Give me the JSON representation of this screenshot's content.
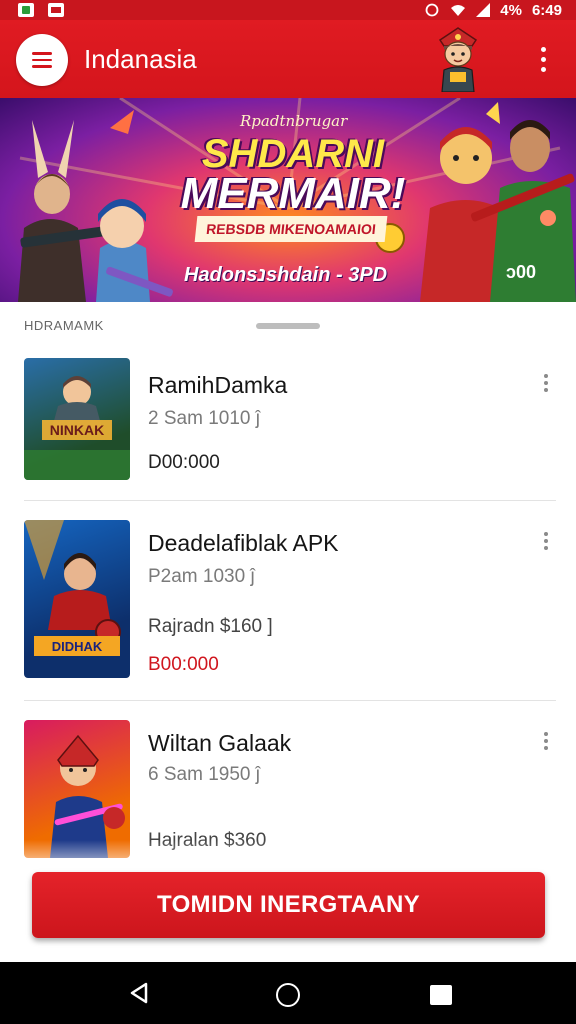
{
  "status_bar": {
    "left_icons": [
      "gallery-icon",
      "image-icon"
    ],
    "signal_text": "4%",
    "time": "6:49"
  },
  "app_bar": {
    "title": "Indanasia",
    "menu_icon": "hamburger-menu-icon",
    "more_icon": "more-vert-icon"
  },
  "banner": {
    "kicker": "Rpadtnbrugar",
    "title_line1": "SHDARNI",
    "title_line2": "MERMAIR!",
    "strip": "REBSDB MIKENOAMAIOI",
    "footer": "Hadonsנshdain - 3PD",
    "badge": "ↄ00"
  },
  "section": {
    "label": "HDRAMAMK"
  },
  "items": [
    {
      "title": "RamihDamka",
      "meta": "2 Sam 1010 ĵ",
      "extra": "",
      "price": "D00:000",
      "price_red": false,
      "thumb_label": "NINKAK",
      "thumb_colors": [
        "#2a6ea8",
        "#1f4d2a",
        "#f2b233"
      ]
    },
    {
      "title": "Deadelafiblak APK",
      "meta": "P2am 1030 ĵ",
      "extra": "Rajradn $160 ]",
      "price": "B00:000",
      "price_red": true,
      "thumb_label": "DIDHAK",
      "thumb_colors": [
        "#1565c0",
        "#b71c1c",
        "#f4a623"
      ]
    },
    {
      "title": "Wiltan Galaak",
      "meta": "6 Sam 1950 ĵ",
      "extra": "Hajralan $360",
      "price": "",
      "price_red": false,
      "thumb_label": "",
      "thumb_colors": [
        "#d81b60",
        "#ef6c00",
        "#1e3a8a"
      ]
    }
  ],
  "cta": {
    "label": "TOMIDN INERGTAANY"
  },
  "nav_bar": {
    "back_icon": "back-triangle-icon",
    "home_icon": "home-circle-icon",
    "recents_icon": "recents-square-icon"
  },
  "colors": {
    "primary": "#d4151c",
    "banner_gold": "#ffe84a",
    "text_dark": "#151515",
    "text_muted": "#7a7a7a"
  }
}
